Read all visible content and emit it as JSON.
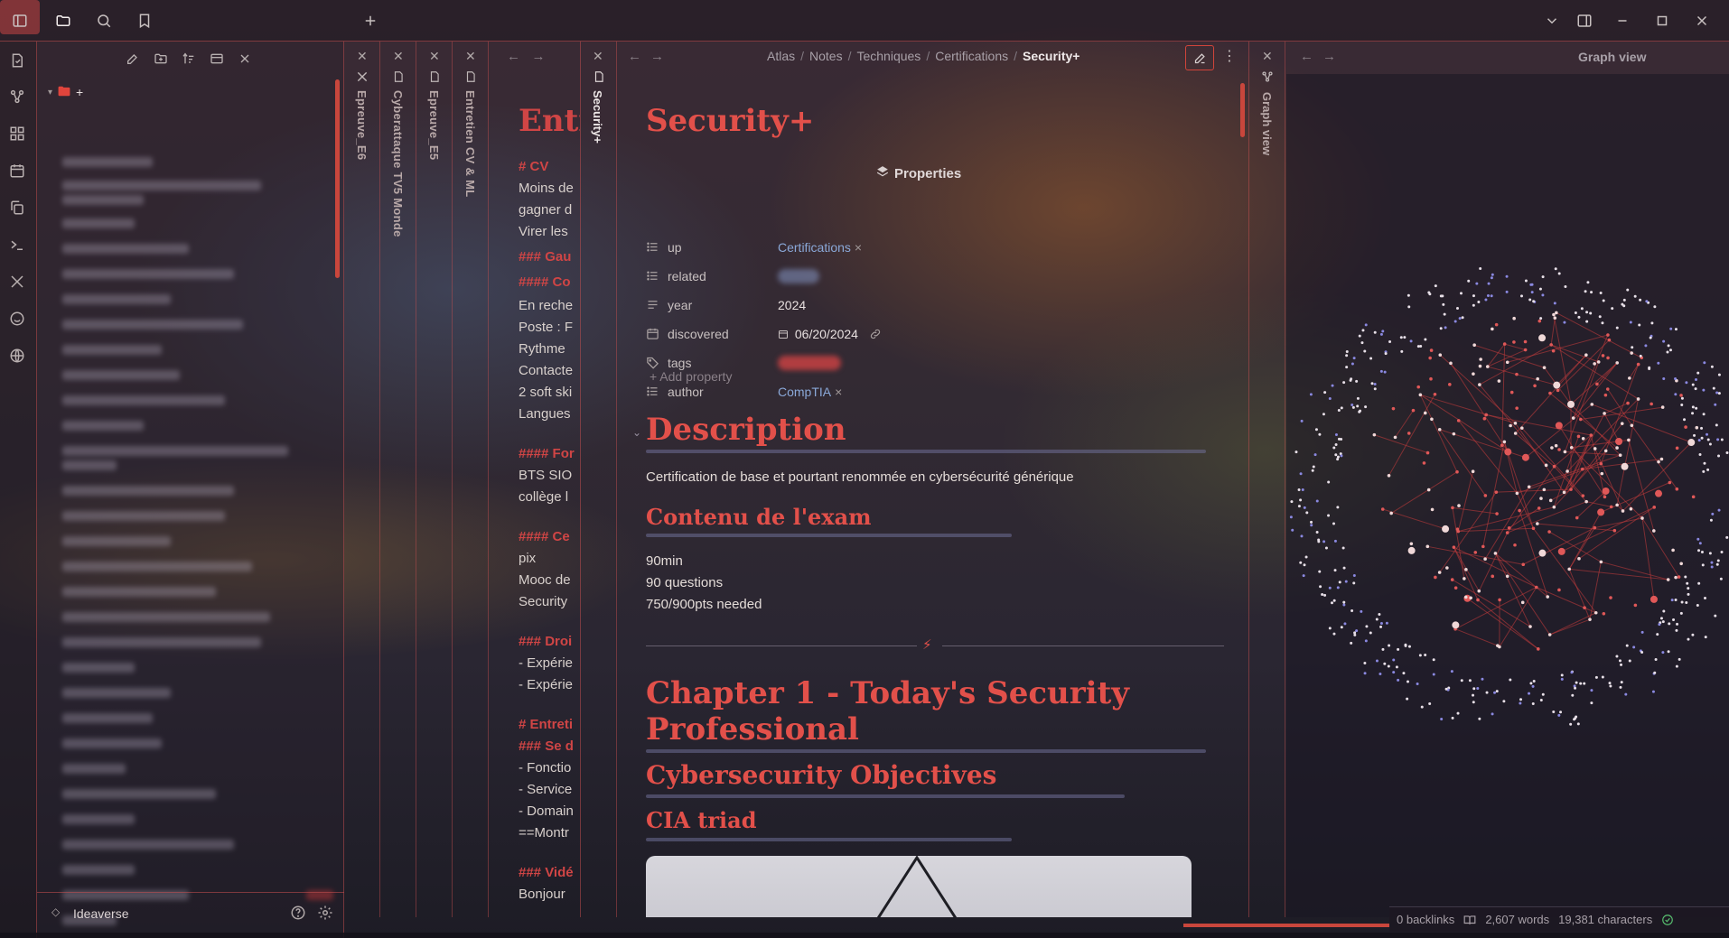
{
  "colors": {
    "accent": "#e2504a",
    "link": "#8aa8d8",
    "border": "#c9463c"
  },
  "titlebar": {
    "icons": [
      "sidebar-toggle-icon",
      "folder-icon",
      "search-icon",
      "bookmark-icon",
      "plus-icon"
    ],
    "right_icons": [
      "chevron-down-icon",
      "split-view-icon",
      "minimize-icon",
      "maximize-icon",
      "close-icon"
    ]
  },
  "sidebar": {
    "root_label": "+",
    "vault_name": "Ideaverse"
  },
  "stacked_tabs": [
    {
      "title": "Epreuve_E6"
    },
    {
      "title": "Cyberattaque TV5 Monde"
    },
    {
      "title": "Epreuve_E5"
    },
    {
      "title": "Entretien CV & ML"
    }
  ],
  "behind_note": {
    "title": "Entr",
    "lines": [
      {
        "hash": "# ",
        "text": "CV",
        "h": true
      },
      {
        "hash": "",
        "text": "Moins de",
        "h": false
      },
      {
        "hash": "",
        "text": "gagner d",
        "h": false
      },
      {
        "hash": "",
        "text": "Virer les",
        "h": false
      },
      {
        "hash": "### ",
        "text": "Gau",
        "h": true
      },
      {
        "hash": "#### ",
        "text": "Co",
        "h": true
      },
      {
        "hash": "",
        "text": " En reche",
        "h": false
      },
      {
        "hash": "",
        "text": " Poste : F",
        "h": false
      },
      {
        "hash": "",
        "text": " Rythme",
        "h": false
      },
      {
        "hash": "",
        "text": "Contacte",
        "h": false
      },
      {
        "hash": "",
        "text": "2 soft ski",
        "h": false
      },
      {
        "hash": "",
        "text": "Langues",
        "h": false
      },
      {
        "hash": "#### ",
        "text": "For",
        "h": true
      },
      {
        "hash": "",
        "text": " BTS SIO",
        "h": false
      },
      {
        "hash": "",
        "text": " collège l",
        "h": false
      },
      {
        "hash": "#### ",
        "text": "Ce",
        "h": true
      },
      {
        "hash": "",
        "text": " pix",
        "h": false
      },
      {
        "hash": "",
        "text": " Mooc de",
        "h": false
      },
      {
        "hash": "",
        "text": " Security",
        "h": false
      },
      {
        "hash": "### ",
        "text": "Droi",
        "h": true
      },
      {
        "hash": "",
        "text": "- Expérie",
        "h": false
      },
      {
        "hash": "",
        "text": "- Expérie",
        "h": false
      },
      {
        "hash": "# ",
        "text": "Entreti",
        "h": true
      },
      {
        "hash": "### ",
        "text": "Se d",
        "h": true
      },
      {
        "hash": "",
        "text": "- Fonctio",
        "h": false
      },
      {
        "hash": "",
        "text": "- Service",
        "h": false
      },
      {
        "hash": "",
        "text": "- Domain",
        "h": false
      },
      {
        "hash": "",
        "text": "==Montr",
        "h": false
      },
      {
        "hash": "### ",
        "text": "Vidé",
        "h": true
      },
      {
        "hash": "",
        "text": "Bonjour",
        "h": false
      }
    ]
  },
  "main_tab": {
    "title": "Security+",
    "breadcrumb": [
      "Atlas",
      "Notes",
      "Techniques",
      "Certifications",
      "Security+"
    ]
  },
  "note": {
    "title": "Security+",
    "properties_label": "Properties",
    "properties": [
      {
        "key": "up",
        "value": "Certifications",
        "link": true,
        "icon": "list-icon"
      },
      {
        "key": "related",
        "value": "",
        "link": true,
        "icon": "list-icon"
      },
      {
        "key": "year",
        "value": "2024",
        "link": false,
        "icon": "text-icon"
      },
      {
        "key": "discovered",
        "value": "06/20/2024",
        "link": false,
        "icon": "calendar-icon"
      },
      {
        "key": "tags",
        "value": "",
        "link": false,
        "icon": "tag-icon"
      },
      {
        "key": "author",
        "value": "CompTIA",
        "link": true,
        "icon": "list-icon"
      }
    ],
    "add_property": "+ Add property",
    "description_heading": "Description",
    "description_text": "Certification de base et pourtant renommée en cybersécurité générique",
    "exam_heading": "Contenu de l'exam",
    "exam_lines": [
      "90min",
      "90 questions",
      "750/900pts needed"
    ],
    "chapter_heading_1": "Chapter 1 - Today's Security",
    "chapter_heading_2": "Professional",
    "objectives_heading": "Cybersecurity Objectives",
    "cia_heading": "CIA triad"
  },
  "graph": {
    "title": "Graph view",
    "tab_title": "Graph view"
  },
  "status": {
    "backlinks": "0 backlinks",
    "words": "2,607 words",
    "characters": "19,381 characters"
  }
}
